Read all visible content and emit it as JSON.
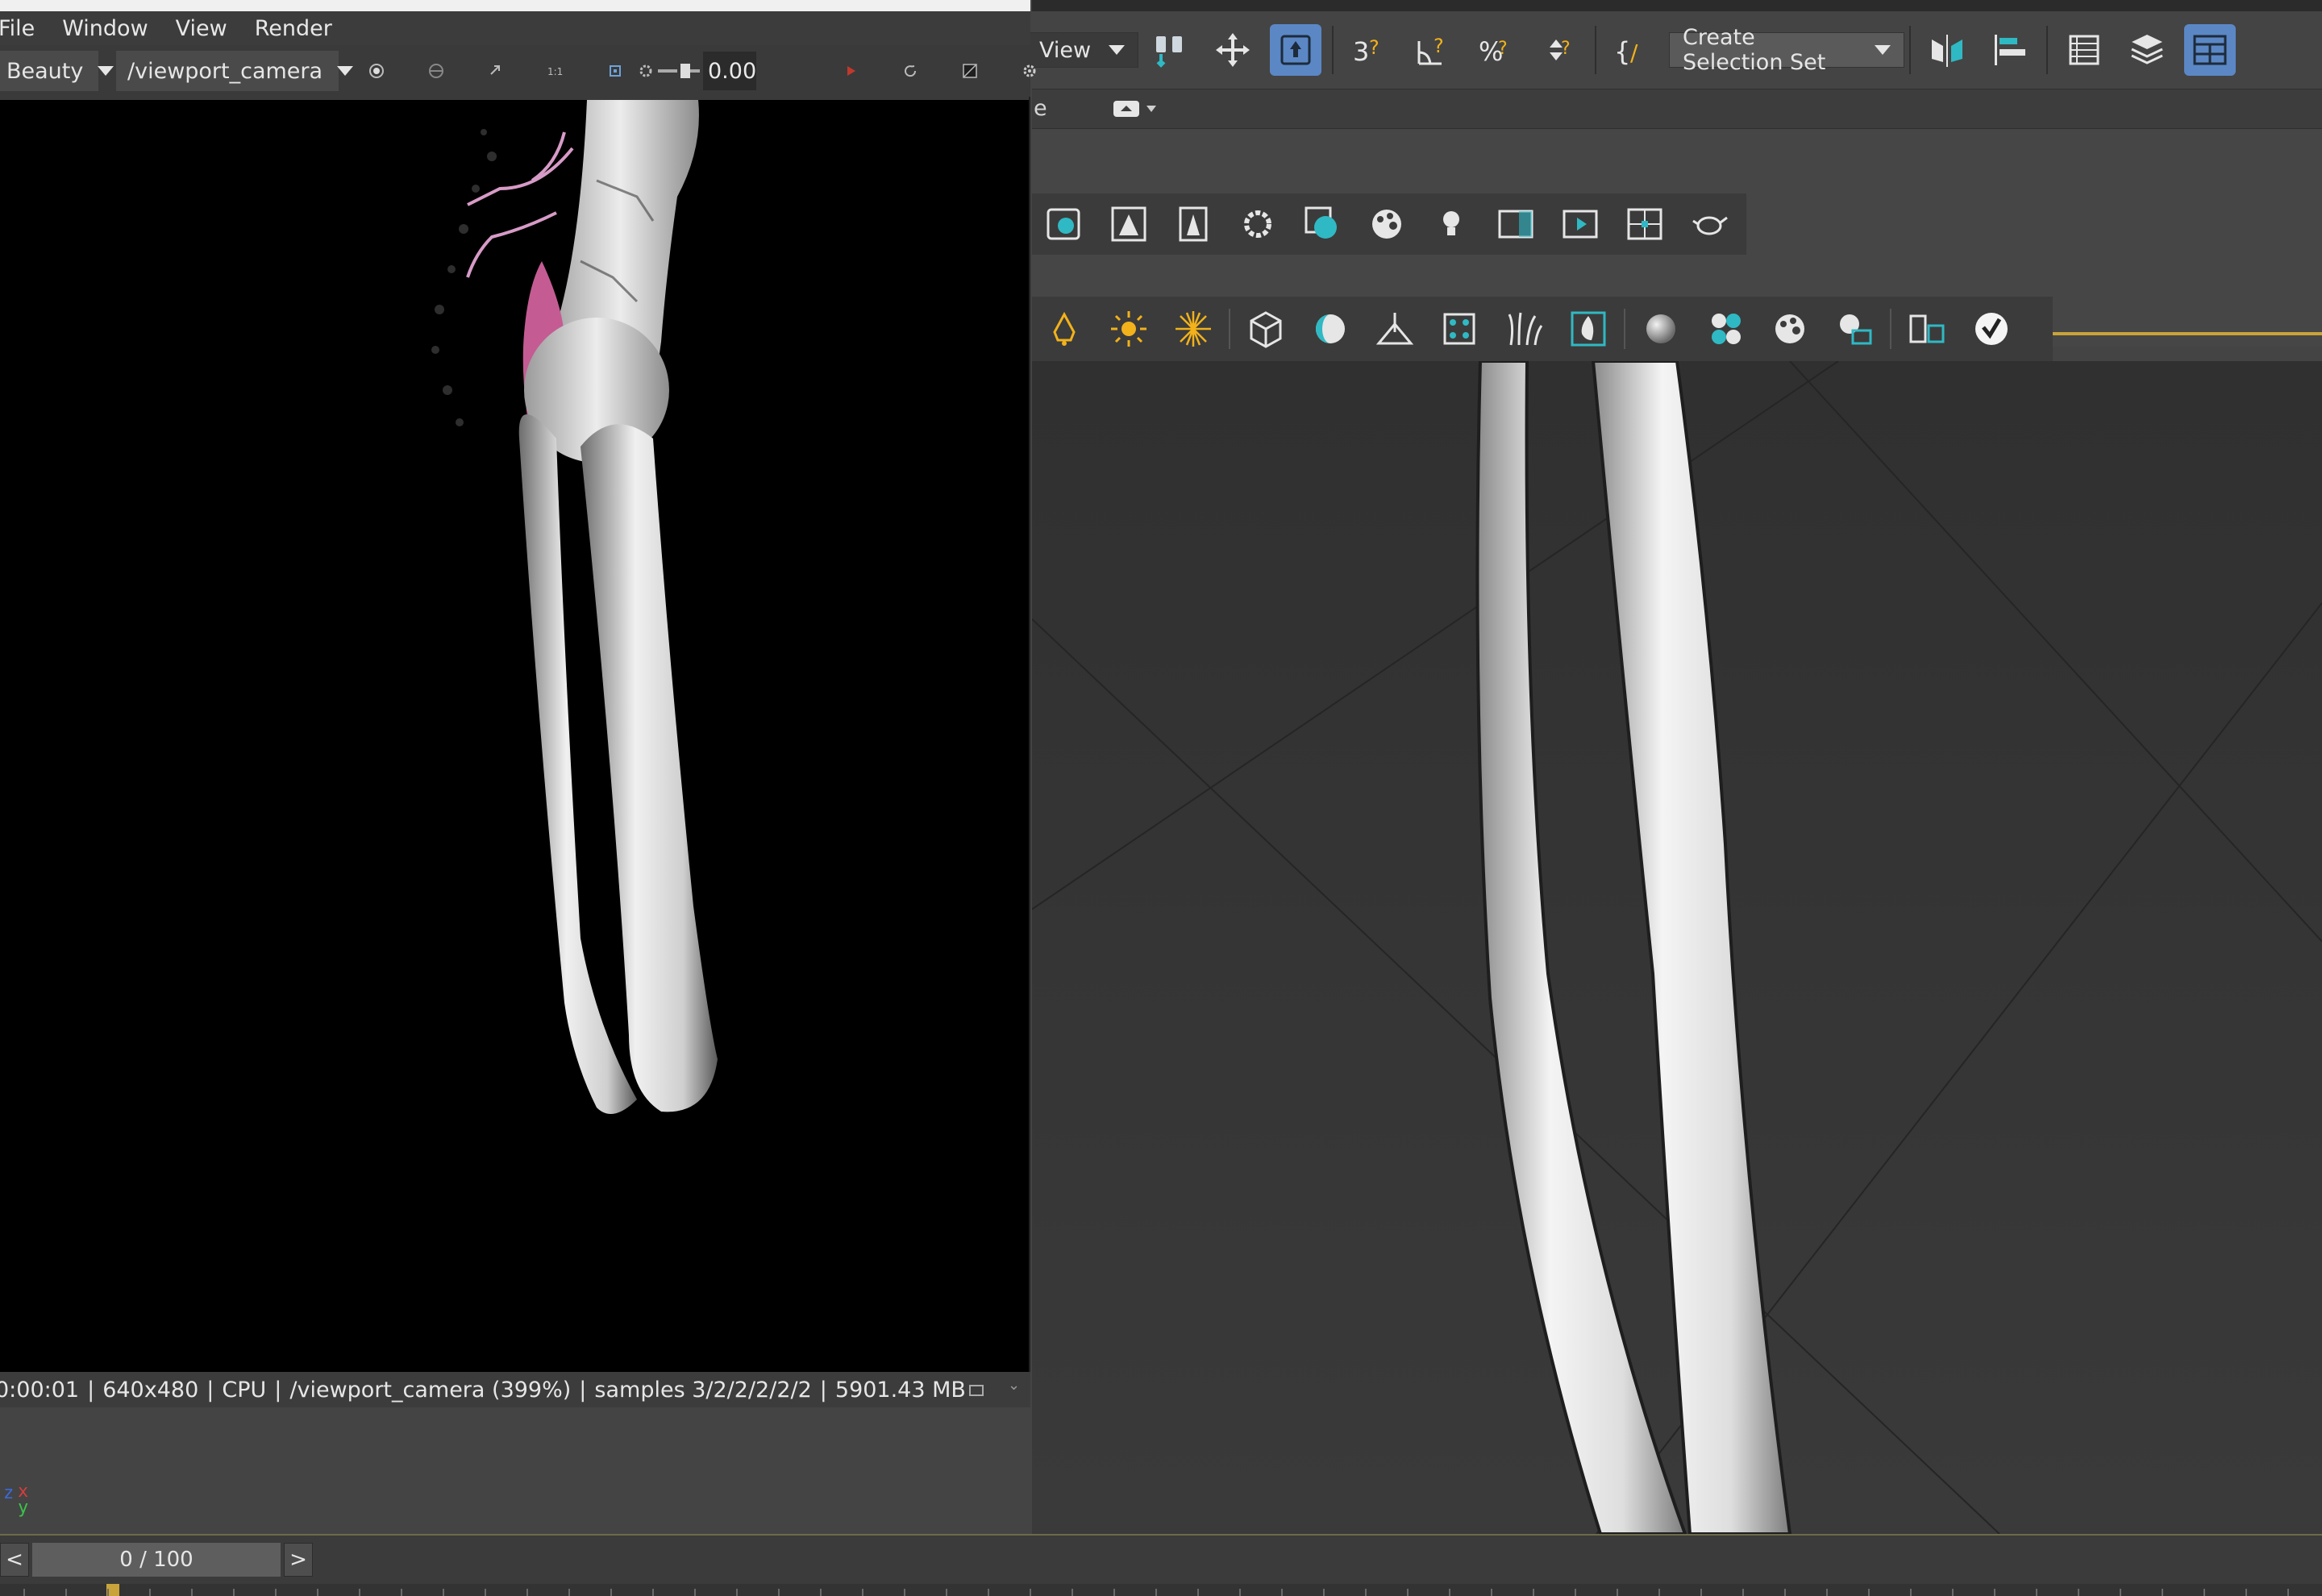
{
  "render_window": {
    "menu": [
      "File",
      "Window",
      "View",
      "Render"
    ],
    "aov_dropdown": "Beauty",
    "camera_dropdown": "/viewport_camera",
    "exposure_value": "0.00",
    "status": {
      "time": "0:00:01",
      "resolution": "640x480",
      "device": "CPU",
      "camera": "/viewport_camera (399%)",
      "samples": "samples 3/2/2/2/2/2",
      "memory": "5901.43 MB"
    },
    "separator": "|"
  },
  "main_toolbar": {
    "view_dropdown": "View",
    "selection_set": "Create Selection Set",
    "row2_label": "e"
  },
  "timeline": {
    "frame": "0 / 100",
    "prev": "<",
    "next": ">"
  },
  "axis": {
    "x": "x",
    "y": "y",
    "z": "z"
  },
  "colors": {
    "accent_blue": "#5b87c5",
    "icon_yellow": "#f2b21b",
    "icon_teal": "#2fb9c4",
    "timeline_accent": "#c9a43a"
  }
}
